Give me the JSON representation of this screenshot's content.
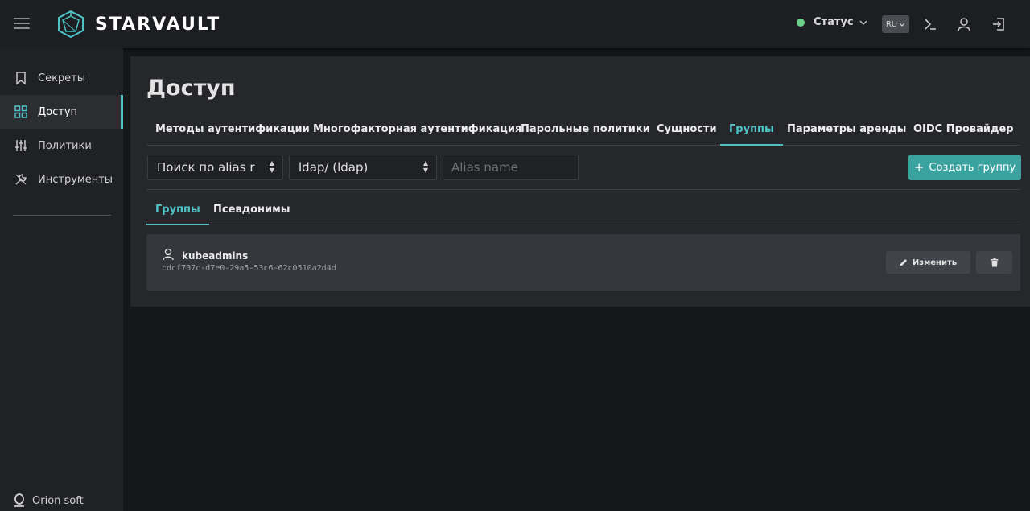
{
  "header": {
    "brand": "STARVAULT",
    "status_label": "Статус",
    "status_color": "#6bd18a",
    "language": "RU"
  },
  "sidebar": {
    "items": [
      {
        "label": "Секреты",
        "icon": "bookmark-icon"
      },
      {
        "label": "Доступ",
        "icon": "grid-icon",
        "active": true
      },
      {
        "label": "Политики",
        "icon": "sliders-icon"
      },
      {
        "label": "Инструменты",
        "icon": "tools-icon"
      }
    ],
    "footer": "Orion soft"
  },
  "main": {
    "title": "Доступ",
    "tabs": [
      {
        "label": "Методы аутентификации"
      },
      {
        "label": "Многофакторная аутентификация"
      },
      {
        "label": "Парольные политики"
      },
      {
        "label": "Сущности"
      },
      {
        "label": "Группы",
        "active": true
      },
      {
        "label": "Параметры аренды"
      },
      {
        "label": "OIDC Провайдер"
      }
    ],
    "filters": {
      "search_select": "Поиск по alias r",
      "mount_select": "ldap/ (ldap)",
      "alias_placeholder": "Alias name",
      "create_button": "Создать группу"
    },
    "subtabs": [
      {
        "label": "Группы",
        "active": true
      },
      {
        "label": "Псевдонимы"
      }
    ],
    "groups": [
      {
        "name": "kubeadmins",
        "id": "cdcf707c-d7e0-29a5-53c6-62c0510a2d4d",
        "edit_label": "Изменить"
      }
    ]
  },
  "colors": {
    "accent": "#4fc3c6",
    "button": "#3aa39f",
    "background": "#161719"
  }
}
